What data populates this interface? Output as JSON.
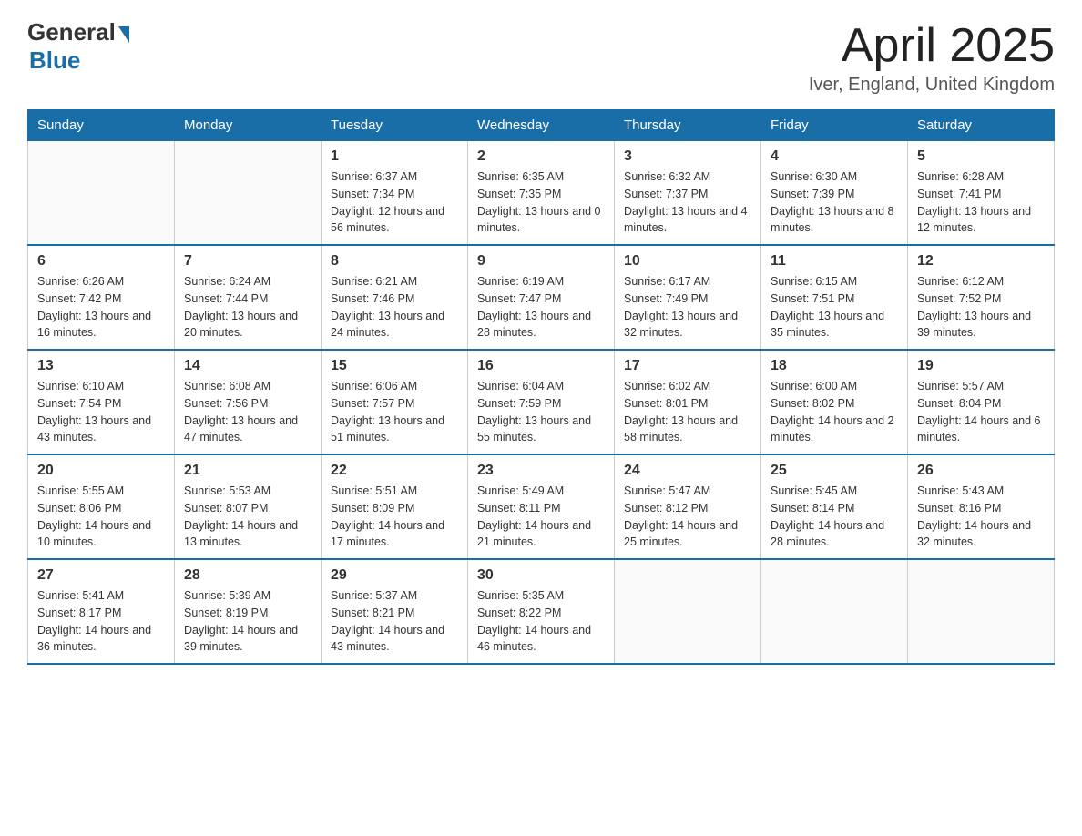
{
  "header": {
    "logo_general": "General",
    "logo_blue": "Blue",
    "title": "April 2025",
    "location": "Iver, England, United Kingdom"
  },
  "days_of_week": [
    "Sunday",
    "Monday",
    "Tuesday",
    "Wednesday",
    "Thursday",
    "Friday",
    "Saturday"
  ],
  "weeks": [
    [
      {
        "day": "",
        "info": ""
      },
      {
        "day": "",
        "info": ""
      },
      {
        "day": "1",
        "sunrise": "Sunrise: 6:37 AM",
        "sunset": "Sunset: 7:34 PM",
        "daylight": "Daylight: 12 hours and 56 minutes."
      },
      {
        "day": "2",
        "sunrise": "Sunrise: 6:35 AM",
        "sunset": "Sunset: 7:35 PM",
        "daylight": "Daylight: 13 hours and 0 minutes."
      },
      {
        "day": "3",
        "sunrise": "Sunrise: 6:32 AM",
        "sunset": "Sunset: 7:37 PM",
        "daylight": "Daylight: 13 hours and 4 minutes."
      },
      {
        "day": "4",
        "sunrise": "Sunrise: 6:30 AM",
        "sunset": "Sunset: 7:39 PM",
        "daylight": "Daylight: 13 hours and 8 minutes."
      },
      {
        "day": "5",
        "sunrise": "Sunrise: 6:28 AM",
        "sunset": "Sunset: 7:41 PM",
        "daylight": "Daylight: 13 hours and 12 minutes."
      }
    ],
    [
      {
        "day": "6",
        "sunrise": "Sunrise: 6:26 AM",
        "sunset": "Sunset: 7:42 PM",
        "daylight": "Daylight: 13 hours and 16 minutes."
      },
      {
        "day": "7",
        "sunrise": "Sunrise: 6:24 AM",
        "sunset": "Sunset: 7:44 PM",
        "daylight": "Daylight: 13 hours and 20 minutes."
      },
      {
        "day": "8",
        "sunrise": "Sunrise: 6:21 AM",
        "sunset": "Sunset: 7:46 PM",
        "daylight": "Daylight: 13 hours and 24 minutes."
      },
      {
        "day": "9",
        "sunrise": "Sunrise: 6:19 AM",
        "sunset": "Sunset: 7:47 PM",
        "daylight": "Daylight: 13 hours and 28 minutes."
      },
      {
        "day": "10",
        "sunrise": "Sunrise: 6:17 AM",
        "sunset": "Sunset: 7:49 PM",
        "daylight": "Daylight: 13 hours and 32 minutes."
      },
      {
        "day": "11",
        "sunrise": "Sunrise: 6:15 AM",
        "sunset": "Sunset: 7:51 PM",
        "daylight": "Daylight: 13 hours and 35 minutes."
      },
      {
        "day": "12",
        "sunrise": "Sunrise: 6:12 AM",
        "sunset": "Sunset: 7:52 PM",
        "daylight": "Daylight: 13 hours and 39 minutes."
      }
    ],
    [
      {
        "day": "13",
        "sunrise": "Sunrise: 6:10 AM",
        "sunset": "Sunset: 7:54 PM",
        "daylight": "Daylight: 13 hours and 43 minutes."
      },
      {
        "day": "14",
        "sunrise": "Sunrise: 6:08 AM",
        "sunset": "Sunset: 7:56 PM",
        "daylight": "Daylight: 13 hours and 47 minutes."
      },
      {
        "day": "15",
        "sunrise": "Sunrise: 6:06 AM",
        "sunset": "Sunset: 7:57 PM",
        "daylight": "Daylight: 13 hours and 51 minutes."
      },
      {
        "day": "16",
        "sunrise": "Sunrise: 6:04 AM",
        "sunset": "Sunset: 7:59 PM",
        "daylight": "Daylight: 13 hours and 55 minutes."
      },
      {
        "day": "17",
        "sunrise": "Sunrise: 6:02 AM",
        "sunset": "Sunset: 8:01 PM",
        "daylight": "Daylight: 13 hours and 58 minutes."
      },
      {
        "day": "18",
        "sunrise": "Sunrise: 6:00 AM",
        "sunset": "Sunset: 8:02 PM",
        "daylight": "Daylight: 14 hours and 2 minutes."
      },
      {
        "day": "19",
        "sunrise": "Sunrise: 5:57 AM",
        "sunset": "Sunset: 8:04 PM",
        "daylight": "Daylight: 14 hours and 6 minutes."
      }
    ],
    [
      {
        "day": "20",
        "sunrise": "Sunrise: 5:55 AM",
        "sunset": "Sunset: 8:06 PM",
        "daylight": "Daylight: 14 hours and 10 minutes."
      },
      {
        "day": "21",
        "sunrise": "Sunrise: 5:53 AM",
        "sunset": "Sunset: 8:07 PM",
        "daylight": "Daylight: 14 hours and 13 minutes."
      },
      {
        "day": "22",
        "sunrise": "Sunrise: 5:51 AM",
        "sunset": "Sunset: 8:09 PM",
        "daylight": "Daylight: 14 hours and 17 minutes."
      },
      {
        "day": "23",
        "sunrise": "Sunrise: 5:49 AM",
        "sunset": "Sunset: 8:11 PM",
        "daylight": "Daylight: 14 hours and 21 minutes."
      },
      {
        "day": "24",
        "sunrise": "Sunrise: 5:47 AM",
        "sunset": "Sunset: 8:12 PM",
        "daylight": "Daylight: 14 hours and 25 minutes."
      },
      {
        "day": "25",
        "sunrise": "Sunrise: 5:45 AM",
        "sunset": "Sunset: 8:14 PM",
        "daylight": "Daylight: 14 hours and 28 minutes."
      },
      {
        "day": "26",
        "sunrise": "Sunrise: 5:43 AM",
        "sunset": "Sunset: 8:16 PM",
        "daylight": "Daylight: 14 hours and 32 minutes."
      }
    ],
    [
      {
        "day": "27",
        "sunrise": "Sunrise: 5:41 AM",
        "sunset": "Sunset: 8:17 PM",
        "daylight": "Daylight: 14 hours and 36 minutes."
      },
      {
        "day": "28",
        "sunrise": "Sunrise: 5:39 AM",
        "sunset": "Sunset: 8:19 PM",
        "daylight": "Daylight: 14 hours and 39 minutes."
      },
      {
        "day": "29",
        "sunrise": "Sunrise: 5:37 AM",
        "sunset": "Sunset: 8:21 PM",
        "daylight": "Daylight: 14 hours and 43 minutes."
      },
      {
        "day": "30",
        "sunrise": "Sunrise: 5:35 AM",
        "sunset": "Sunset: 8:22 PM",
        "daylight": "Daylight: 14 hours and 46 minutes."
      },
      {
        "day": "",
        "info": ""
      },
      {
        "day": "",
        "info": ""
      },
      {
        "day": "",
        "info": ""
      }
    ]
  ]
}
